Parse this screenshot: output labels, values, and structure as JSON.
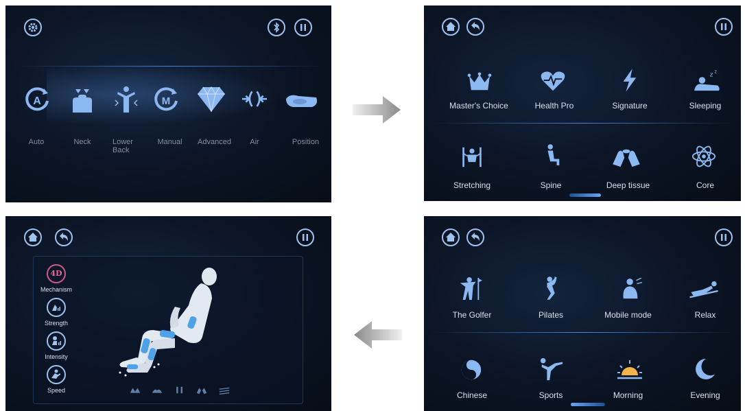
{
  "colors": {
    "accent": "#5d9df2",
    "icon": "#8cb8f2",
    "background": "#0b1424"
  },
  "screen1": {
    "header_icons": [
      "gear-icon",
      "bluetooth-icon",
      "pause-icon"
    ],
    "modes": [
      {
        "icon": "auto-icon",
        "label": "Auto"
      },
      {
        "icon": "neck-icon",
        "label": "Neck"
      },
      {
        "icon": "lower-back-icon",
        "label": "Lower Back"
      },
      {
        "icon": "manual-icon",
        "label": "Manual"
      },
      {
        "icon": "diamond-icon",
        "label": "Advanced"
      },
      {
        "icon": "air-icon",
        "label": "Air"
      },
      {
        "icon": "position-icon",
        "label": "Position"
      }
    ]
  },
  "screen2": {
    "header_icons": [
      "home-icon",
      "back-icon",
      "pause-icon"
    ],
    "programs": [
      {
        "icon": "crown-icon",
        "label": "Master's Choice"
      },
      {
        "icon": "heart-icon",
        "label": "Health Pro"
      },
      {
        "icon": "lightning-icon",
        "label": "Signature"
      },
      {
        "icon": "sleep-icon",
        "label": "Sleeping"
      },
      {
        "icon": "stretch-icon",
        "label": "Stretching"
      },
      {
        "icon": "spine-icon",
        "label": "Spine"
      },
      {
        "icon": "hands-icon",
        "label": "Deep tissue"
      },
      {
        "icon": "atom-icon",
        "label": "Core"
      }
    ]
  },
  "screen3": {
    "header_icons": [
      "home-icon",
      "back-icon",
      "pause-icon"
    ],
    "programs": [
      {
        "icon": "golfer-icon",
        "label": "The Golfer"
      },
      {
        "icon": "pilates-icon",
        "label": "Pilates"
      },
      {
        "icon": "mobile-icon",
        "label": "Mobile mode"
      },
      {
        "icon": "relax-icon",
        "label": "Relax"
      },
      {
        "icon": "yin-yang-icon",
        "label": "Chinese"
      },
      {
        "icon": "sports-icon",
        "label": "Sports"
      },
      {
        "icon": "sunrise-icon",
        "label": "Morning"
      },
      {
        "icon": "moon-icon",
        "label": "Evening"
      }
    ]
  },
  "screen4": {
    "header_icons": [
      "home-icon",
      "back-icon",
      "pause-icon"
    ],
    "mechanism_badge": "4D",
    "controls": [
      {
        "icon": "mechanism-icon",
        "label": "Mechanism"
      },
      {
        "icon": "strength-icon",
        "label": "Strength"
      },
      {
        "icon": "intensity-icon",
        "label": "Intensity"
      },
      {
        "icon": "speed-icon",
        "label": "Speed"
      }
    ],
    "bottom_icons": [
      "foot-icon",
      "calf-icon",
      "leg-icon",
      "hand-icon",
      "heat-icon"
    ]
  }
}
